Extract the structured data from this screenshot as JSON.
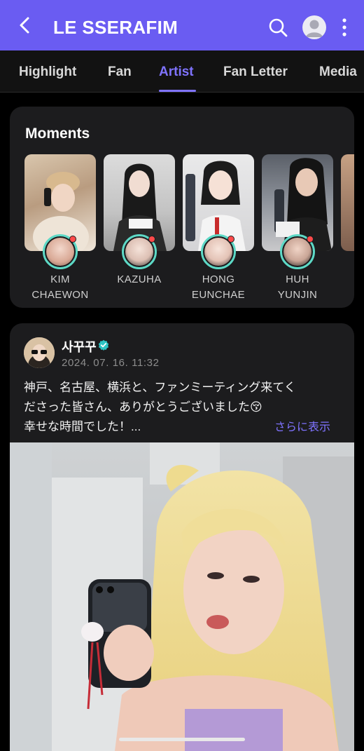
{
  "header": {
    "title": "LE SSERAFIM",
    "back_icon": "chevron-left-icon",
    "search_icon": "search-icon",
    "profile_icon": "avatar-icon",
    "more_icon": "more-vertical-icon",
    "accent": "#6a5cf2"
  },
  "tabs": [
    {
      "label": "Highlight",
      "active": false
    },
    {
      "label": "Fan",
      "active": false
    },
    {
      "label": "Artist",
      "active": true
    },
    {
      "label": "Fan Letter",
      "active": false
    },
    {
      "label": "Media",
      "active": false
    }
  ],
  "moments": {
    "title": "Moments",
    "items": [
      {
        "line1": "KIM",
        "line2": "CHAEWON"
      },
      {
        "line1": "KAZUHA",
        "line2": ""
      },
      {
        "line1": "HONG",
        "line2": "EUNCHAE"
      },
      {
        "line1": "HUH",
        "line2": "YUNJIN"
      }
    ]
  },
  "post": {
    "author": "사꾸꾸",
    "verified_icon": "verified-badge-icon",
    "date": "2024. 07. 16. 11:32",
    "text_lines": [
      "神戸、名古屋、横浜と、ファンミーティング来てく",
      "ださった皆さん、ありがとうございました😚",
      "幸せな時間でした！..."
    ],
    "more_label": "さらに表示"
  }
}
